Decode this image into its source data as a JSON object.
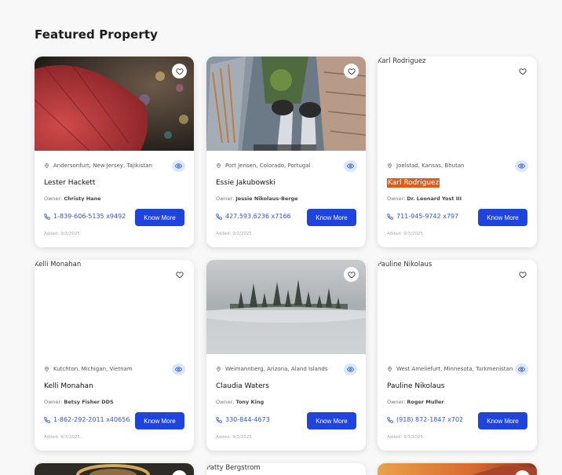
{
  "section_title": "Featured Property",
  "button_label": "Know More",
  "owner_prefix": "Owner:",
  "cards": [
    {
      "name": "Lester Hackett",
      "location": "Andersonfurt, New Jersey, Tajikistan",
      "owner": "Christy Hane",
      "phone": "1-839-606-5135 x9492",
      "added": "Added: 9/3/2025",
      "image": "red-umbrella-photo"
    },
    {
      "name": "Essie Jakubowski",
      "location": "Port Jensen, Colorado, Portugal",
      "owner": "Jessie Nikolaus-Berge",
      "phone": "427.593.6236 x7166",
      "added": "Added: 9/2/2025",
      "image": "feet-over-city-photo"
    },
    {
      "name": "Karl Rodriguez",
      "location": "Joelstad, Kansas, Bhutan",
      "owner": "Dr. Leonard Yost III",
      "phone": "711-945-9742 x797",
      "added": "Added: 9/3/2025",
      "image_alt": "Karl Rodriguez"
    },
    {
      "name": "Kelli Monahan",
      "location": "Kutchton, Michigan, Vietnam",
      "owner": "Betsy Fisher DDS",
      "phone": "1-862-292-2011 x40656",
      "added": "Added: 9/3/2025",
      "image_alt": "Kelli Monahan"
    },
    {
      "name": "Claudia Waters",
      "location": "Weimannberg, Arizona, Aland Islands",
      "owner": "Tony King",
      "phone": "330-844-4673",
      "added": "Added: 9/3/2025",
      "image": "misty-forest-photo"
    },
    {
      "name": "Pauline Nikolaus",
      "location": "West Ameliefurt, Minnesota, Turkmenistan",
      "owner": "Roger Muller",
      "phone": "(918) 872-1847 x702",
      "added": "Added: 9/3/2025",
      "image_alt": "Pauline Nikolaus"
    }
  ],
  "next_row": [
    {
      "image": "golden-ring-photo"
    },
    {
      "image_alt": "Patty Bergstrom"
    },
    {
      "image": "desert-sunset-photo"
    }
  ],
  "colors": {
    "accent": "#1f44dd",
    "highlight": "#e25b12",
    "link": "#2f55d4"
  },
  "icons": {
    "favorite": "heart-icon",
    "location": "map-pin-icon",
    "view": "eye-icon",
    "phone": "phone-icon"
  }
}
